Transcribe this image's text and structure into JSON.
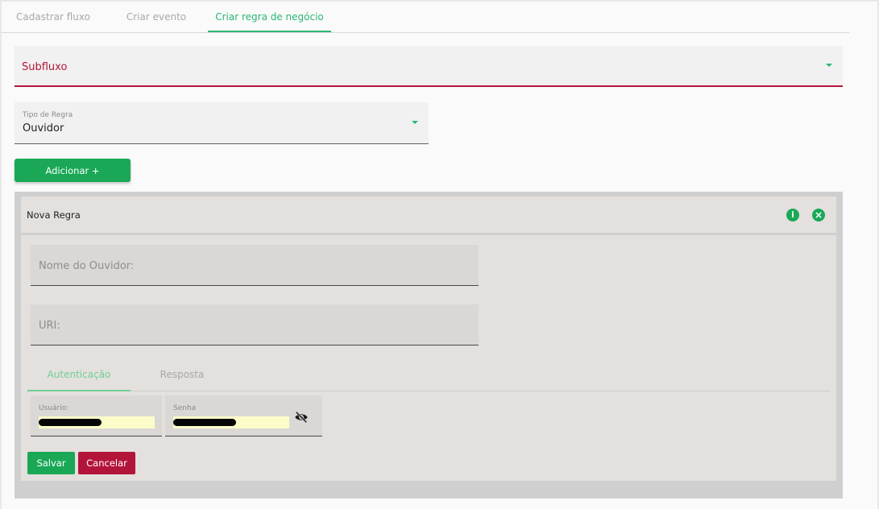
{
  "tabs": [
    {
      "label": "Cadastrar fluxo"
    },
    {
      "label": "Criar evento"
    },
    {
      "label": "Criar regra de negócio"
    }
  ],
  "subfluxo": {
    "label": "Subfluxo"
  },
  "tipo_regra": {
    "label": "Tipo de Regra",
    "value": "Ouvidor"
  },
  "add_button": {
    "label": "Adicionar +"
  },
  "rule": {
    "title": "Nova Regra",
    "info_icon": "info-icon",
    "close_icon": "close-circle-icon",
    "nome_ouvidor_placeholder": "Nome do Ouvidor:",
    "uri_placeholder": "URI:",
    "subtabs": [
      {
        "label": "Autenticação"
      },
      {
        "label": "Resposta"
      }
    ],
    "usuario_label": "Usuário:",
    "senha_label": "Senha",
    "eye_icon": "eye-off-icon",
    "save_label": "Salvar",
    "cancel_label": "Cancelar"
  },
  "colors": {
    "accent_green": "#1aa856",
    "tab_active": "#2bb673",
    "error_red": "#b3153a",
    "autofill": "#fcfcca"
  }
}
